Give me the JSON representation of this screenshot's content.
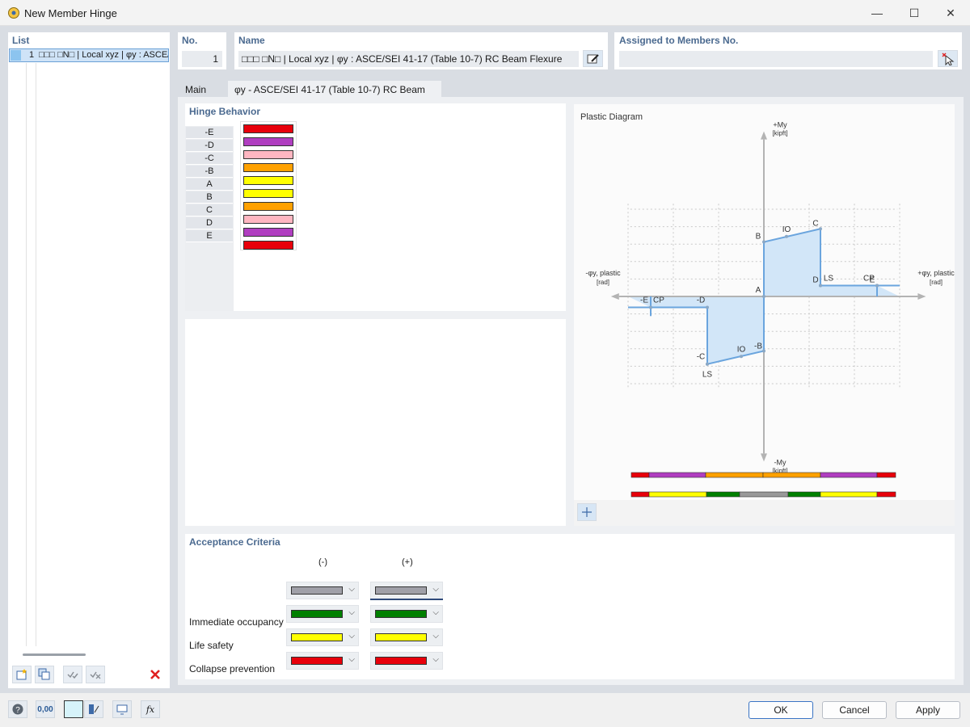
{
  "window": {
    "title": "New Member Hinge",
    "minimize": "—",
    "maximize": "☐",
    "close": "✕"
  },
  "list": {
    "header": "List",
    "items": [
      {
        "number": "1",
        "text": "□□□ □N□ | Local xyz | φy : ASCE/SEI 41-17 (Table 10-7) RC Beam Flexure"
      }
    ]
  },
  "number": {
    "label": "No.",
    "value": "1"
  },
  "name": {
    "label": "Name",
    "value": "□□□ □N□ | Local xyz | φy : ASCE/SEI 41-17 (Table 10-7) RC Beam Flexure"
  },
  "assigned": {
    "label": "Assigned to Members No.",
    "value": ""
  },
  "tabs": [
    {
      "label": "Main"
    },
    {
      "label": "φy - ASCE/SEI 41-17 (Table 10-7) RC Beam Flexure"
    }
  ],
  "hinge_behavior": {
    "title": "Hinge Behavior",
    "rows": [
      {
        "label": "-E",
        "color": "#e8000b"
      },
      {
        "label": "-D",
        "color": "#b03ec0"
      },
      {
        "label": "-C",
        "color": "#ffb6c1"
      },
      {
        "label": "-B",
        "color": "#ffa100"
      },
      {
        "label": "A",
        "color": "#ffff00"
      },
      {
        "label": "B",
        "color": "#ffff00"
      },
      {
        "label": "C",
        "color": "#ffa100"
      },
      {
        "label": "D",
        "color": "#ffb6c1"
      },
      {
        "label": "E",
        "color": "#b03ec0"
      },
      {
        "label": "",
        "color": "#e8000b"
      }
    ]
  },
  "plastic_diagram": {
    "title": "Plastic Diagram",
    "y_pos_label": "+My",
    "y_pos_unit": "[kipft]",
    "y_neg_label": "-My",
    "y_neg_unit": "[kipft]",
    "x_neg_label": "-φy, plastic",
    "x_neg_unit": "[rad]",
    "x_pos_label": "+φy, plastic",
    "x_pos_unit": "[rad]",
    "color_bar_top": [
      "#e8000b",
      "#b03ec0",
      "#ffa100",
      "#ffa100",
      "#b03ec0",
      "#e8000b"
    ],
    "color_bar_bottom": [
      "#e8000b",
      "#ffff00",
      "#008000",
      "#999999",
      "#008000",
      "#ffff00",
      "#e8000b"
    ]
  },
  "chart_data": {
    "type": "line",
    "title": "Plastic Diagram",
    "xlabel": "φy, plastic [rad]",
    "ylabel": "My [kipft]",
    "grid": true,
    "series": [
      {
        "points": [
          {
            "label": "-E",
            "x": -2.5,
            "y": -0.5
          },
          {
            "label": "-D",
            "x": -1.25,
            "y": -0.5
          },
          {
            "label": "-C",
            "x": -1.25,
            "y": -3.1
          },
          {
            "label": "-B",
            "x": 0,
            "y": -2.5
          },
          {
            "label": "A",
            "x": 0,
            "y": 0
          },
          {
            "label": "B",
            "x": 0,
            "y": 2.5
          },
          {
            "label": "C",
            "x": 1.25,
            "y": 3.1
          },
          {
            "label": "D",
            "x": 1.25,
            "y": 0.5
          },
          {
            "label": "E",
            "x": 2.5,
            "y": 0.5
          }
        ]
      }
    ],
    "markers": [
      {
        "label": "IO",
        "x": 0.5,
        "y": 2.75
      },
      {
        "label": "LS",
        "x": 1.25,
        "y": 0.5
      },
      {
        "label": "CP",
        "x": 2.5,
        "y": 0.5
      },
      {
        "label": "IO",
        "x": -0.5,
        "y": -2.75
      },
      {
        "label": "LS",
        "x": -1.25,
        "y": -3.1
      },
      {
        "label": "CP",
        "x": -2.5,
        "y": -0.5
      }
    ]
  },
  "acceptance": {
    "title": "Acceptance Criteria",
    "col_neg": "(-)",
    "col_pos": "(+)",
    "rows": [
      {
        "label": "",
        "neg_color": "#a0a0a8",
        "pos_color": "#a0a0a8"
      },
      {
        "label": "Immediate occupancy",
        "neg_color": "#008000",
        "pos_color": "#008000"
      },
      {
        "label": "Life safety",
        "neg_color": "#ffff00",
        "pos_color": "#ffff00"
      },
      {
        "label": "Collapse prevention",
        "neg_color": "#e8000b",
        "pos_color": "#e8000b"
      }
    ]
  },
  "buttons": {
    "ok": "OK",
    "cancel": "Cancel",
    "apply": "Apply"
  },
  "status_bar": {
    "decimals_label": "0,00"
  }
}
